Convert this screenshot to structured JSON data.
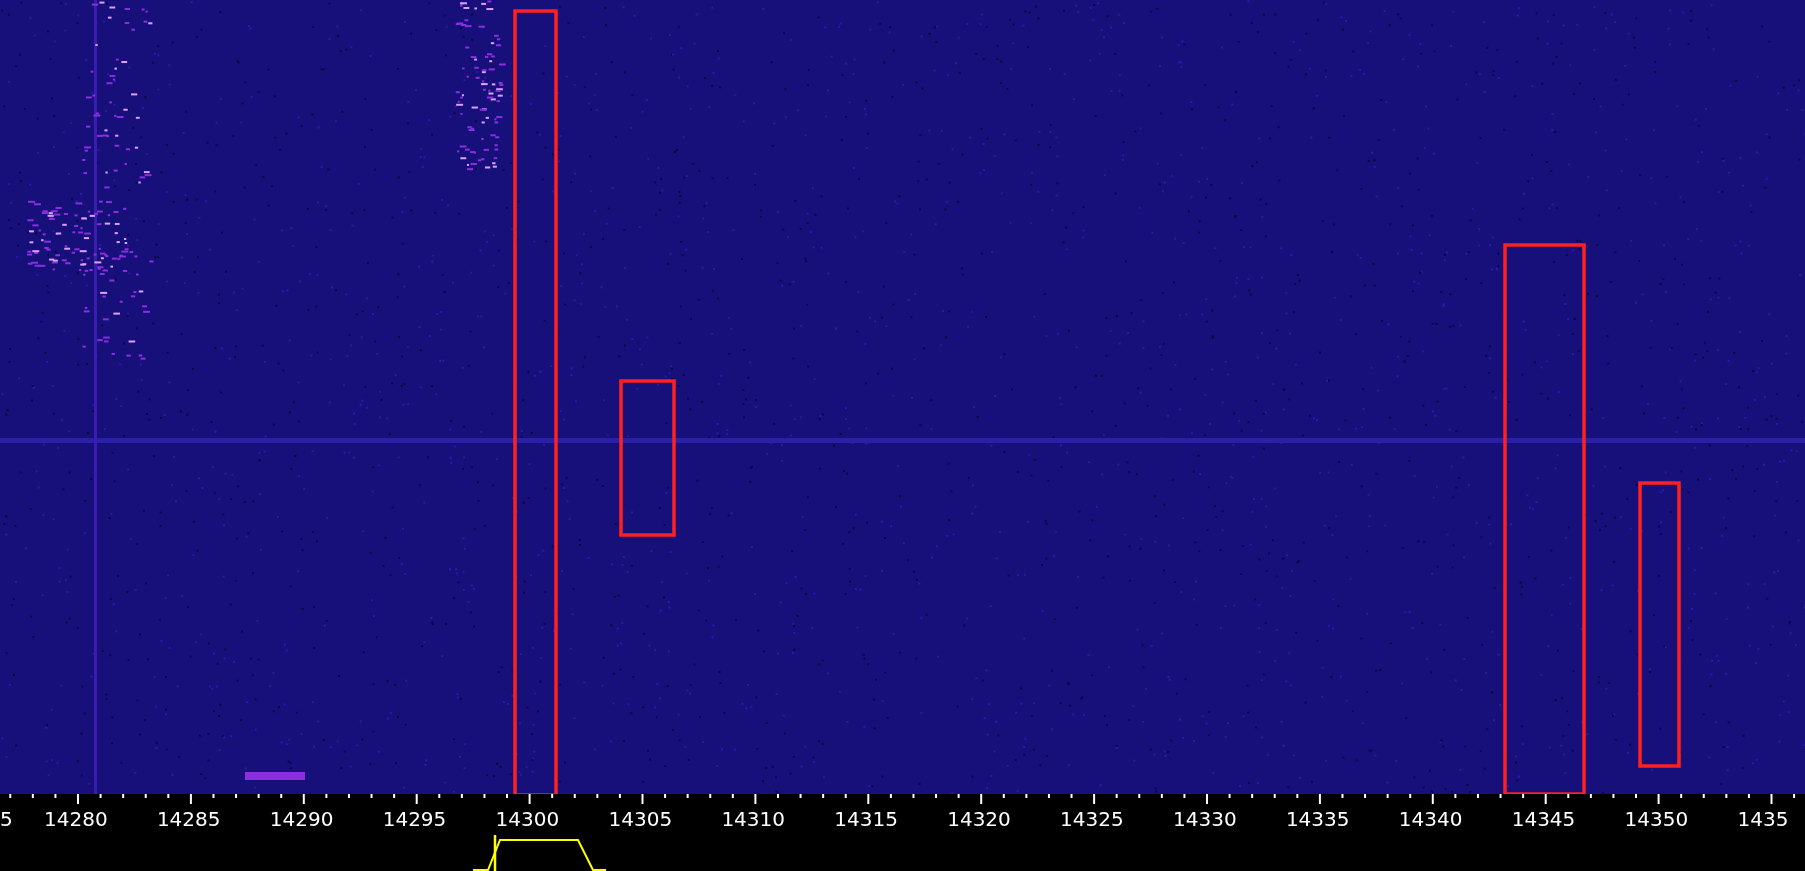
{
  "frequency_axis": {
    "labels": [
      {
        "text": "5",
        "kind": "cut_left"
      },
      {
        "text": "14280",
        "kind": "full"
      },
      {
        "text": "14285",
        "kind": "full"
      },
      {
        "text": "14290",
        "kind": "full"
      },
      {
        "text": "14295",
        "kind": "full"
      },
      {
        "text": "14300",
        "kind": "full"
      },
      {
        "text": "14305",
        "kind": "full"
      },
      {
        "text": "14310",
        "kind": "full"
      },
      {
        "text": "14315",
        "kind": "full"
      },
      {
        "text": "14320",
        "kind": "full"
      },
      {
        "text": "14325",
        "kind": "full"
      },
      {
        "text": "14330",
        "kind": "full"
      },
      {
        "text": "14335",
        "kind": "full"
      },
      {
        "text": "14340",
        "kind": "full"
      },
      {
        "text": "14345",
        "kind": "full"
      },
      {
        "text": "14350",
        "kind": "full"
      },
      {
        "text": "1435",
        "kind": "cut_right"
      }
    ]
  }
}
